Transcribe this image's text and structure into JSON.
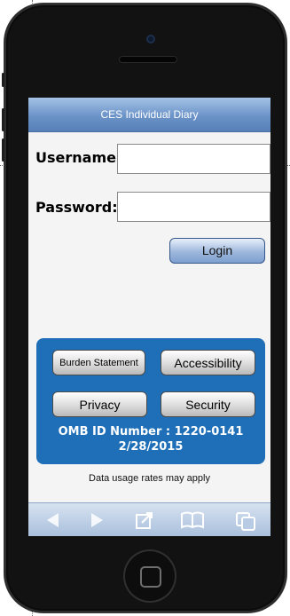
{
  "app": {
    "title": "CES Individual Diary"
  },
  "login_form": {
    "username_label": "Username:",
    "username_value": "",
    "password_label": "Password:",
    "password_value": "",
    "login_button": "Login"
  },
  "info_panel": {
    "buttons": {
      "burden_statement": "Burden Statement",
      "accessibility": "Accessibility",
      "privacy": "Privacy",
      "security": "Security"
    },
    "omb_line1": "OMB ID Number : 1220-0141",
    "omb_line2": "2/28/2015"
  },
  "footer_note": "Data usage rates may apply",
  "browser_toolbar": {
    "icons": [
      "back-arrow-icon",
      "forward-arrow-icon",
      "share-icon",
      "bookmarks-icon",
      "tabs-icon"
    ]
  },
  "colors": {
    "title_bar": "#6b93c8",
    "panel_blue": "#1e6fb8",
    "login_button": "#9db7dc"
  }
}
